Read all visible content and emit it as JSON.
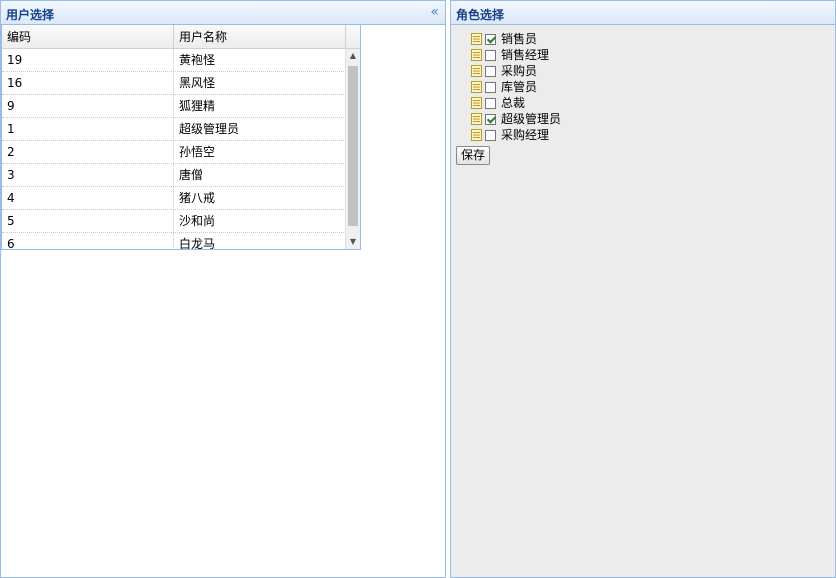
{
  "left_panel": {
    "title": "用户选择",
    "collapse_icon": "double-chevron-left-icon",
    "grid": {
      "columns": [
        "编码",
        "用户名称"
      ],
      "rows": [
        {
          "id": "19",
          "name": "黄袍怪"
        },
        {
          "id": "16",
          "name": "黑风怪"
        },
        {
          "id": "9",
          "name": "狐狸精"
        },
        {
          "id": "1",
          "name": "超级管理员"
        },
        {
          "id": "2",
          "name": "孙悟空"
        },
        {
          "id": "3",
          "name": "唐僧"
        },
        {
          "id": "4",
          "name": "猪八戒"
        },
        {
          "id": "5",
          "name": "沙和尚"
        },
        {
          "id": "6",
          "name": "白龙马"
        }
      ]
    }
  },
  "right_panel": {
    "title": "角色选择",
    "roles": [
      {
        "label": "销售员",
        "checked": true,
        "icon": "document-icon"
      },
      {
        "label": "销售经理",
        "checked": false,
        "icon": "document-icon"
      },
      {
        "label": "采购员",
        "checked": false,
        "icon": "document-icon"
      },
      {
        "label": "库管员",
        "checked": false,
        "icon": "document-icon"
      },
      {
        "label": "总裁",
        "checked": false,
        "icon": "document-icon"
      },
      {
        "label": "超级管理员",
        "checked": true,
        "icon": "document-icon"
      },
      {
        "label": "采购经理",
        "checked": false,
        "icon": "document-icon"
      }
    ],
    "save_label": "保存"
  },
  "colors": {
    "header_title": "#15428b",
    "panel_border": "#99bbe8",
    "right_background": "#ececec"
  }
}
